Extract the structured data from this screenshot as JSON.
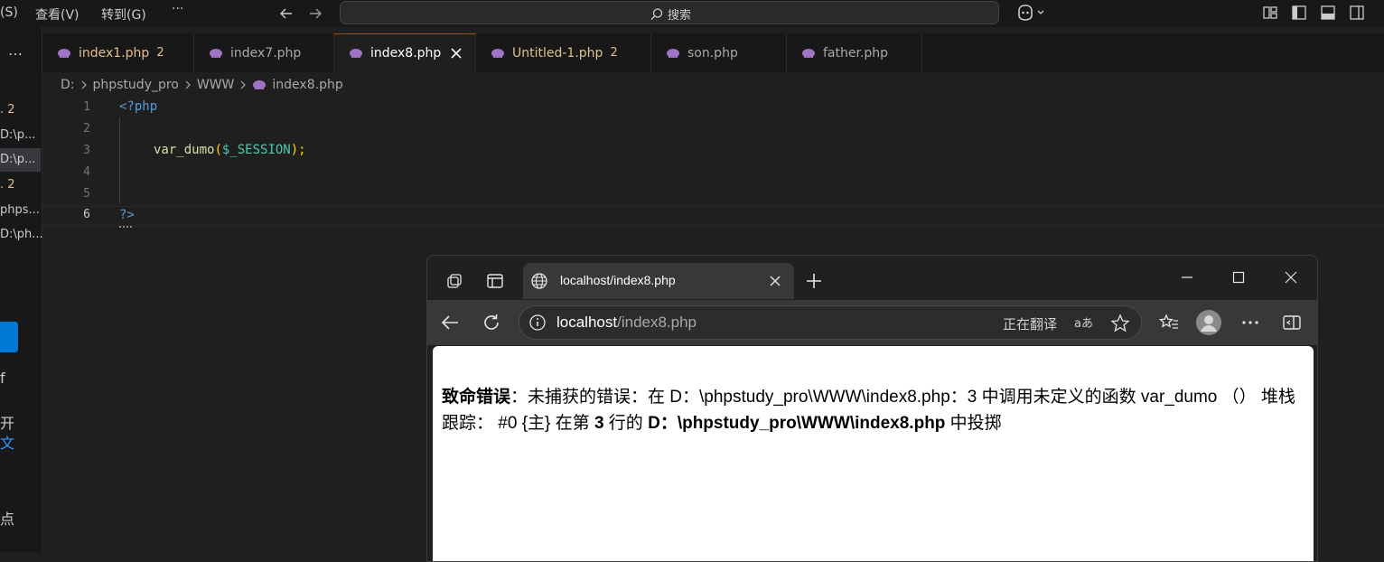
{
  "titlebar": {
    "menu": [
      "(S)",
      "查看(V)",
      "转到(G)",
      "···"
    ],
    "search_placeholder": "搜索"
  },
  "left_panel": {
    "items": [
      "…",
      ". 2",
      "D:\\p...",
      "D:\\p...",
      ". 2",
      "phps...",
      "D:\\ph...",
      "f",
      "开",
      "文",
      "点"
    ]
  },
  "tabs": [
    {
      "label": "index1.php",
      "badge": "2",
      "color": "#e2c08d"
    },
    {
      "label": "index7.php",
      "badge": "",
      "color": "#a9a9a9"
    },
    {
      "label": "index8.php",
      "badge": "",
      "color": "#ffffff",
      "active": true
    },
    {
      "label": "Untitled-1.php",
      "badge": "2",
      "color": "#e2c08d"
    },
    {
      "label": "son.php",
      "badge": "",
      "color": "#a9a9a9"
    },
    {
      "label": "father.php",
      "badge": "",
      "color": "#a9a9a9"
    }
  ],
  "breadcrumb": [
    "D:",
    "phpstudy_pro",
    "WWW",
    "index8.php"
  ],
  "editor": {
    "line_numbers": [
      "1",
      "2",
      "3",
      "4",
      "5",
      "6"
    ],
    "code": {
      "open_tag": "<?php",
      "fn_name": "var_dumo",
      "paren_open": "(",
      "var": "$_SESSION",
      "paren_close_semi": ");",
      "close_tag": "?>"
    }
  },
  "browser": {
    "tab_title": "localhost/index8.php",
    "address_host": "localhost",
    "address_path": "/index8.php",
    "translate_label": "正在翻译",
    "error": {
      "label": "致命错误",
      "part1": "：未捕获的错误：在 D：\\phpstudy_pro\\WWW\\index8.php：3 中调用未定义的函数 var_dumo （） 堆栈跟踪： #0 {主} 在第 ",
      "line": "3",
      "part2": " 行的 ",
      "path": "D：\\phpstudy_pro\\WWW\\index8.php",
      "part3": " 中投掷"
    }
  },
  "colors": {
    "accent": "#0078d4",
    "php_icon": "#a074c4",
    "keyword_blue": "#569cd6",
    "function_yellow": "#dcdcaa",
    "variable_teal": "#4ec9b0",
    "bracket_gold": "#ffd700"
  }
}
